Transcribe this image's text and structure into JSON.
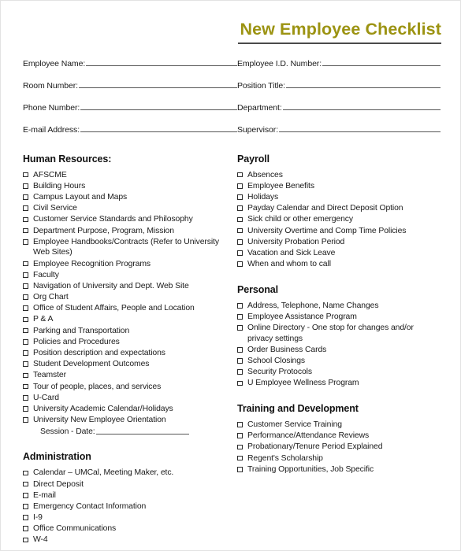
{
  "document": {
    "title": "New Employee Checklist",
    "checkbox_glyph": "empty-square",
    "accent_color": "#9c9312",
    "rule_color": "#4a4a4a"
  },
  "form_fields": {
    "left": [
      {
        "label": "Employee Name:",
        "value": ""
      },
      {
        "label": "Room Number:",
        "value": ""
      },
      {
        "label": "Phone Number:",
        "value": ""
      },
      {
        "label": "E-mail Address:",
        "value": ""
      }
    ],
    "right": [
      {
        "label": "Employee I.D. Number:",
        "value": ""
      },
      {
        "label": "Position Title:",
        "value": ""
      },
      {
        "label": "Department:",
        "value": ""
      },
      {
        "label": "Supervisor:",
        "value": ""
      }
    ]
  },
  "sections": {
    "left": [
      {
        "heading": "Human Resources:",
        "items": [
          {
            "text": "AFSCME"
          },
          {
            "text": "Building Hours"
          },
          {
            "text": "Campus Layout and Maps"
          },
          {
            "text": "Civil Service"
          },
          {
            "text": "Customer Service Standards and Philosophy"
          },
          {
            "text": "Department Purpose, Program, Mission"
          },
          {
            "text": "Employee Handbooks/Contracts (Refer to University Web Sites)"
          },
          {
            "text": "Employee Recognition Programs"
          },
          {
            "text": "Faculty"
          },
          {
            "text": "Navigation of University and Dept. Web Site"
          },
          {
            "text": "Org Chart"
          },
          {
            "text": "Office of Student Affairs, People and Location"
          },
          {
            "text": "P & A"
          },
          {
            "text": "Parking and Transportation"
          },
          {
            "text": "Policies and Procedures"
          },
          {
            "text": "Position description and expectations"
          },
          {
            "text": "Student Development Outcomes"
          },
          {
            "text": "Teamster"
          },
          {
            "text": "Tour of people, places, and services"
          },
          {
            "text": "U-Card"
          },
          {
            "text": "University Academic Calendar/Holidays"
          },
          {
            "text": "University New Employee Orientation",
            "sub_label": "Session - Date:",
            "sub_fill_line": true
          }
        ]
      },
      {
        "heading": "Administration",
        "items": [
          {
            "text": "Calendar – UMCal, Meeting Maker, etc."
          },
          {
            "text": "Direct Deposit"
          },
          {
            "text": "E-mail"
          },
          {
            "text": "Emergency Contact Information"
          },
          {
            "text": "I-9"
          },
          {
            "text": "Office Communications"
          },
          {
            "text": "W-4"
          }
        ]
      }
    ],
    "right": [
      {
        "heading": "Payroll",
        "items": [
          {
            "text": "Absences"
          },
          {
            "text": "Employee Benefits"
          },
          {
            "text": "Holidays"
          },
          {
            "text": "Payday Calendar and Direct Deposit Option"
          },
          {
            "text": "Sick child or other emergency"
          },
          {
            "text": "University Overtime and Comp Time Policies"
          },
          {
            "text": "University Probation Period"
          },
          {
            "text": "Vacation and Sick Leave"
          },
          {
            "text": "When and whom to call"
          }
        ]
      },
      {
        "heading": "Personal",
        "items": [
          {
            "text": "Address, Telephone, Name Changes"
          },
          {
            "text": "Employee Assistance Program"
          },
          {
            "text": "Online Directory - One stop for changes and/or privacy settings"
          },
          {
            "text": "Order Business Cards"
          },
          {
            "text": "School Closings"
          },
          {
            "text": "Security Protocols"
          },
          {
            "text": "U Employee Wellness Program"
          }
        ]
      },
      {
        "heading": "Training and Development",
        "items": [
          {
            "text": "Customer Service Training"
          },
          {
            "text": "Performance/Attendance Reviews"
          },
          {
            "text": "Probationary/Tenure Period Explained"
          },
          {
            "text": "Regent's Scholarship"
          },
          {
            "text": "Training Opportunities, Job Specific"
          }
        ]
      }
    ]
  }
}
